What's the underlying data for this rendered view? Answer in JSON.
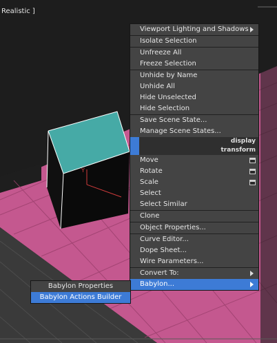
{
  "viewport": {
    "label": "Realistic ]"
  },
  "menu": {
    "items": [
      {
        "label": "Viewport Lighting and Shadows",
        "submenu": true
      },
      {
        "label": "Isolate Selection"
      },
      {
        "label": "Unfreeze All"
      },
      {
        "label": "Freeze Selection"
      },
      {
        "label": "Unhide by Name"
      },
      {
        "label": "Unhide All"
      },
      {
        "label": "Hide Unselected"
      },
      {
        "label": "Hide Selection"
      },
      {
        "label": "Save Scene State..."
      },
      {
        "label": "Manage Scene States..."
      }
    ],
    "quad_display": "display",
    "quad_transform": "transform",
    "transform_items": [
      {
        "label": "Move"
      },
      {
        "label": "Rotate"
      },
      {
        "label": "Scale"
      },
      {
        "label": "Select"
      },
      {
        "label": "Select Similar"
      },
      {
        "label": "Clone"
      },
      {
        "label": "Object Properties..."
      },
      {
        "label": "Curve Editor..."
      },
      {
        "label": "Dope Sheet..."
      },
      {
        "label": "Wire Parameters..."
      },
      {
        "label": "Convert To:"
      },
      {
        "label": "Babylon..."
      }
    ]
  },
  "submenu": {
    "items": [
      {
        "label": "Babylon Properties"
      },
      {
        "label": "Babylon Actions Builder"
      }
    ]
  }
}
